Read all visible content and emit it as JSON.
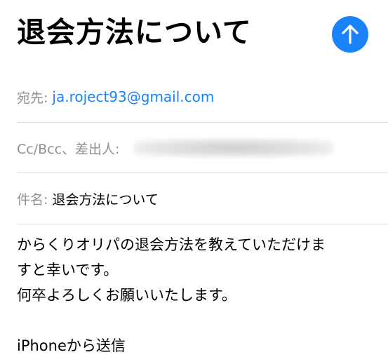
{
  "title": "退会方法について",
  "send_button": {
    "icon": "arrow-up-icon",
    "color": "#1a82fb"
  },
  "to": {
    "label": "宛先:",
    "value": "ja.roject93@gmail.com"
  },
  "cc": {
    "label": "Cc/Bcc、差出人:"
  },
  "subject": {
    "label": "件名:",
    "value": "退会方法について"
  },
  "body": {
    "line1": "からくりオリパの退会方法を教えていただけま",
    "line2": "すと幸いです。",
    "line3": "何卒よろしくお願いいたします。",
    "signature": "iPhoneから送信"
  }
}
